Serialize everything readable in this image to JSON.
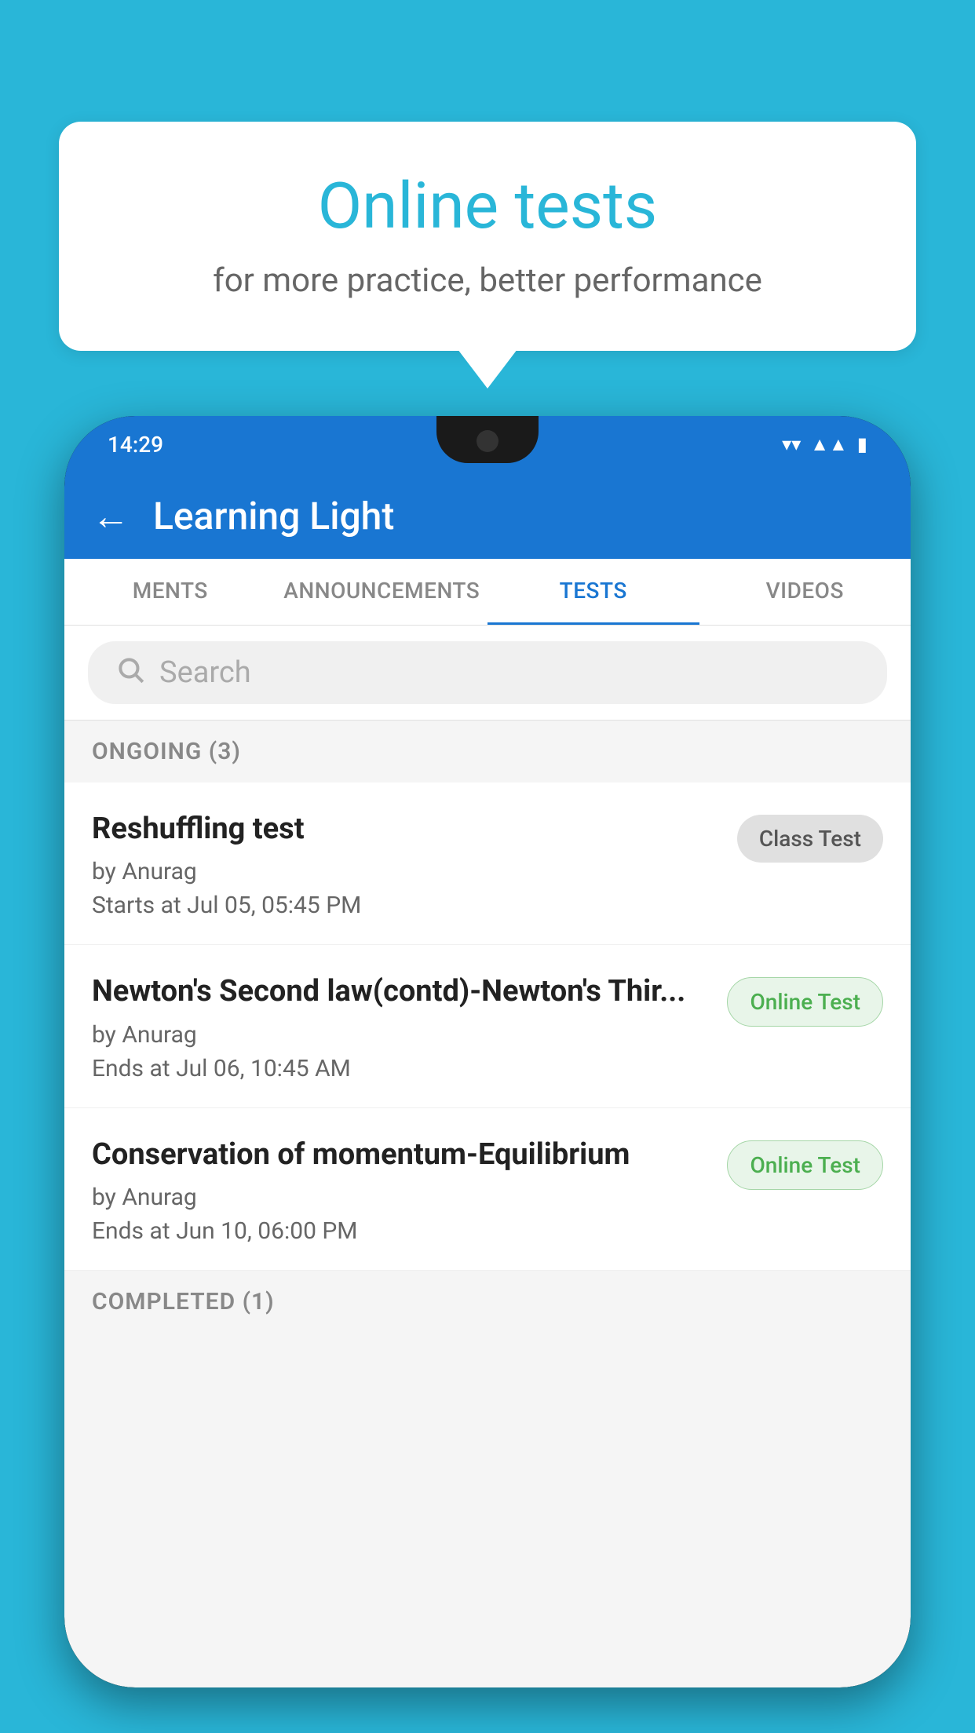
{
  "background_color": "#29b6d8",
  "speech_bubble": {
    "title": "Online tests",
    "subtitle": "for more practice, better performance"
  },
  "phone": {
    "status_bar": {
      "time": "14:29",
      "icons": [
        "wifi",
        "signal",
        "battery"
      ]
    },
    "app_bar": {
      "title": "Learning Light",
      "back_label": "←"
    },
    "tabs": [
      {
        "label": "MENTS",
        "active": false
      },
      {
        "label": "ANNOUNCEMENTS",
        "active": false
      },
      {
        "label": "TESTS",
        "active": true
      },
      {
        "label": "VIDEOS",
        "active": false
      }
    ],
    "search": {
      "placeholder": "Search"
    },
    "ongoing_section": {
      "label": "ONGOING (3)"
    },
    "tests": [
      {
        "title": "Reshuffling test",
        "author": "by Anurag",
        "time_label": "Starts at",
        "time": "Jul 05, 05:45 PM",
        "badge": "Class Test",
        "badge_type": "class"
      },
      {
        "title": "Newton's Second law(contd)-Newton's Thir...",
        "author": "by Anurag",
        "time_label": "Ends at",
        "time": "Jul 06, 10:45 AM",
        "badge": "Online Test",
        "badge_type": "online"
      },
      {
        "title": "Conservation of momentum-Equilibrium",
        "author": "by Anurag",
        "time_label": "Ends at",
        "time": "Jun 10, 06:00 PM",
        "badge": "Online Test",
        "badge_type": "online"
      }
    ],
    "completed_section": {
      "label": "COMPLETED (1)"
    }
  }
}
